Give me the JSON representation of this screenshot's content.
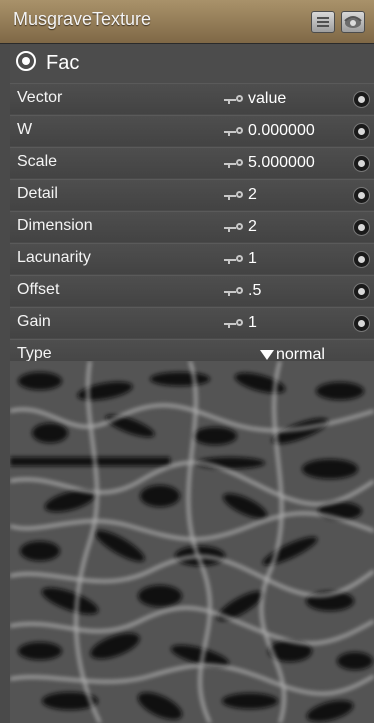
{
  "node": {
    "title": "MusgraveTexture",
    "output_label": "Fac"
  },
  "params": [
    {
      "label": "Vector",
      "value": "value"
    },
    {
      "label": "W",
      "value": "0.000000"
    },
    {
      "label": "Scale",
      "value": "5.000000"
    },
    {
      "label": "Detail",
      "value": "2"
    },
    {
      "label": "Dimension",
      "value": "2"
    },
    {
      "label": "Lacunarity",
      "value": "1"
    },
    {
      "label": "Offset",
      "value": ".5"
    },
    {
      "label": "Gain",
      "value": "1"
    }
  ],
  "type_field": {
    "label": "Type",
    "selected": "normal"
  },
  "colors": {
    "titlebar": "#a9926a",
    "row_bg": "#4a4a4a",
    "text": "#f0f0f0"
  }
}
